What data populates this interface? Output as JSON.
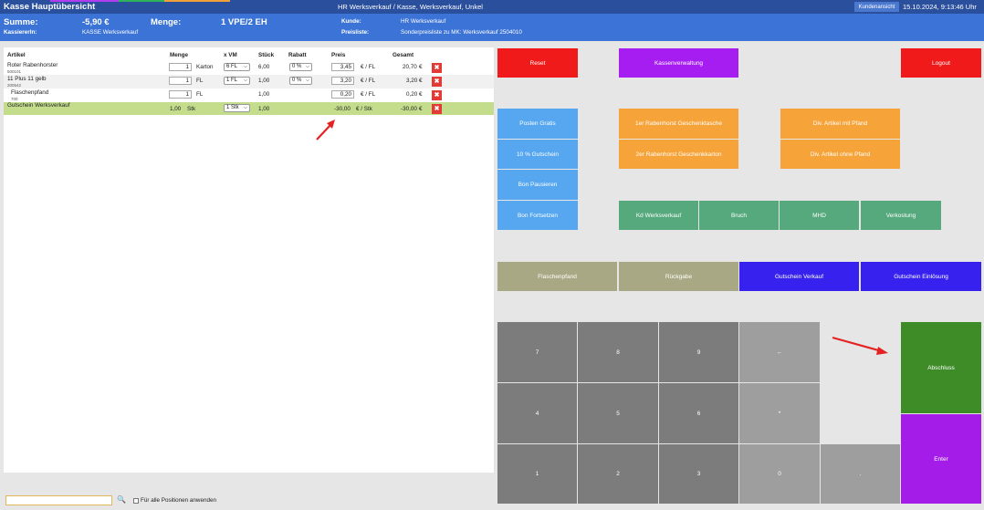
{
  "header": {
    "title": "Kasse Hauptübersicht",
    "context": "HR Werksverkauf / Kasse, Werksverkauf, Unkel",
    "customer_view_button": "Kundenansicht",
    "datetime": "15.10.2024, 9:13:46 Uhr",
    "accent_colors": [
      "#b23cf0",
      "#2fb35a",
      "#f2a13a"
    ]
  },
  "summary": {
    "sum_label": "Summe:",
    "sum_value": "-5,90 €",
    "qty_label": "Menge:",
    "qty_value": "1 VPE/2 EH",
    "cashier_label": "KassiererIn:",
    "cashier_value": "KASSE Werksverkauf",
    "customer_label": "Kunde:",
    "customer_value": "HR Werksverkauf",
    "pricelist_label": "Preisliste:",
    "pricelist_value": "Sonderpreisliste zu MK: Werksverkauf 2504010"
  },
  "table": {
    "headers": {
      "artikel": "Artikel",
      "menge": "Menge",
      "xvm": "x VM",
      "stueck": "Stück",
      "rabatt": "Rabatt",
      "preis": "Preis",
      "gesamt": "Gesamt"
    },
    "rows": [
      {
        "name": "Roter Rabenhorster",
        "code": "500101",
        "qty": "1",
        "unit": "Karton",
        "vm": "6 FL",
        "pieces": "6,00",
        "discount": "0 %",
        "price": "3,45",
        "price_unit": "€ / FL",
        "total": "20,70",
        "currency": "€"
      },
      {
        "name": "11 Plus 11 gelb",
        "code": "200542",
        "qty": "1",
        "unit": "FL",
        "vm": "1 FL",
        "pieces": "1,00",
        "discount": "0 %",
        "price": "3,20",
        "price_unit": "€ / FL",
        "total": "3,20",
        "currency": "€"
      },
      {
        "name": "Flaschenpfand",
        "code": "700",
        "qty": "1",
        "unit": "FL",
        "pieces": "1,00",
        "price": "0,20",
        "price_unit": "€ / FL",
        "total": "0,20",
        "currency": "€"
      },
      {
        "name": "Gutschein Werksverkauf",
        "qty": "1,00",
        "unit": "Stk",
        "vm": "1 Stk",
        "pieces": "1,00",
        "price": "-30,00",
        "price_unit": "€ / Stk",
        "total": "-30,00",
        "currency": "€"
      }
    ]
  },
  "footer": {
    "search_placeholder": "",
    "apply_all_label": "Für alle Positionen anwenden"
  },
  "buttons": {
    "reset": "Reset",
    "kassenverwaltung": "Kassenverwaltung",
    "logout": "Logout",
    "posten_gratis": "Posten Gratis",
    "rabenhorst_tasche": "1er Rabenhorst Geschenktasche",
    "div_mit_pfand": "Div. Artikel mit Pfand",
    "gutschein_10": "10 % Gutschein",
    "rabenhorst_karton": "2er Rabenhorst Geschenkkarton",
    "div_ohne_pfand": "Div. Artikel ohne Pfand",
    "bon_pausieren": "Bon Pausieren",
    "bon_fortsetzen": "Bon Fortsetzen",
    "kd_werksverkauf": "Kd Werksverkauf",
    "bruch": "Bruch",
    "mhd": "MHD",
    "verkostung": "Verkostung",
    "flaschenpfand": "Flaschenpfand",
    "rueckgabe": "Rückgabe",
    "gutschein_verkauf": "Gutschein Verkauf",
    "gutschein_einloesung": "Gutschein Einlösung",
    "abschluss": "Abschluss",
    "enter": "Enter"
  },
  "keypad": {
    "k7": "7",
    "k8": "8",
    "k9": "9",
    "backspace": "←",
    "k4": "4",
    "k5": "5",
    "k6": "6",
    "multiply": "*",
    "k1": "1",
    "k2": "2",
    "k3": "3",
    "k0": "0",
    "decimal": "."
  }
}
